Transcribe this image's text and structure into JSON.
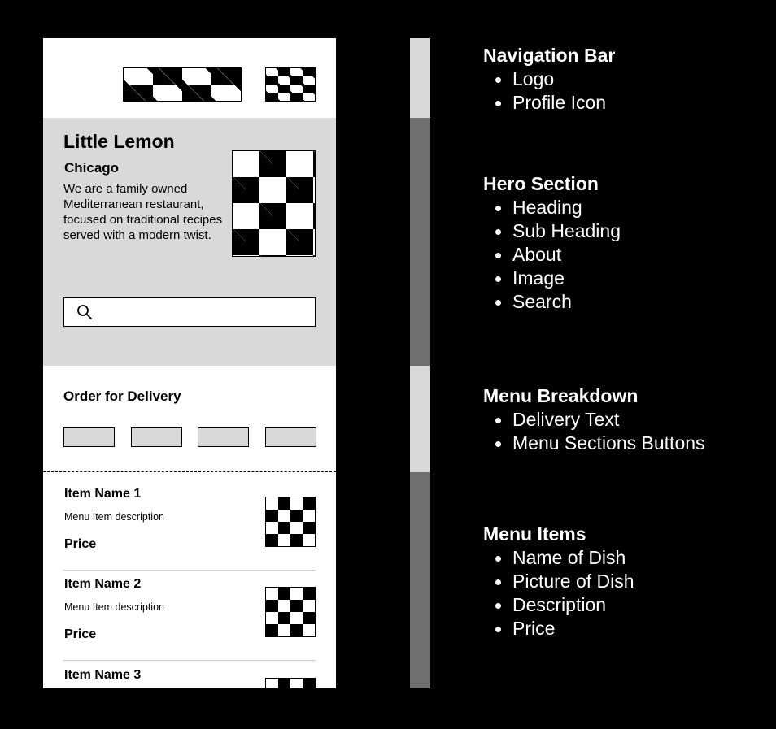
{
  "colors": {
    "background": "#000000",
    "panel": "#ffffff",
    "hero_bg": "#d9d9d9",
    "bar_light": "#d9d9d9",
    "bar_dark": "#6f6f6f"
  },
  "wireframe": {
    "navbar": {
      "logo_icon": "placeholder-image",
      "profile_icon": "placeholder-image"
    },
    "hero": {
      "heading": "Little Lemon",
      "subheading": "Chicago",
      "about": "We are a family owned Mediterranean restaurant, focused on traditional recipes served with a modern twist.",
      "search_icon": "search-icon"
    },
    "menu_breakdown": {
      "delivery_text": "Order for Delivery"
    },
    "menu_items": [
      {
        "name": "Item Name 1",
        "description": "Menu Item description",
        "price": "Price"
      },
      {
        "name": "Item Name 2",
        "description": "Menu Item description",
        "price": "Price"
      },
      {
        "name": "Item Name 3",
        "description": "",
        "price": ""
      }
    ]
  },
  "annotations": [
    {
      "title": "Navigation Bar",
      "items": [
        "Logo",
        "Profile Icon"
      ]
    },
    {
      "title": "Hero Section",
      "items": [
        "Heading",
        "Sub Heading",
        "About",
        "Image",
        "Search"
      ]
    },
    {
      "title": "Menu Breakdown",
      "items": [
        "Delivery Text",
        "Menu Sections Buttons"
      ]
    },
    {
      "title": "Menu Items",
      "items": [
        "Name of Dish",
        "Picture of Dish",
        "Description",
        "Price"
      ]
    }
  ]
}
